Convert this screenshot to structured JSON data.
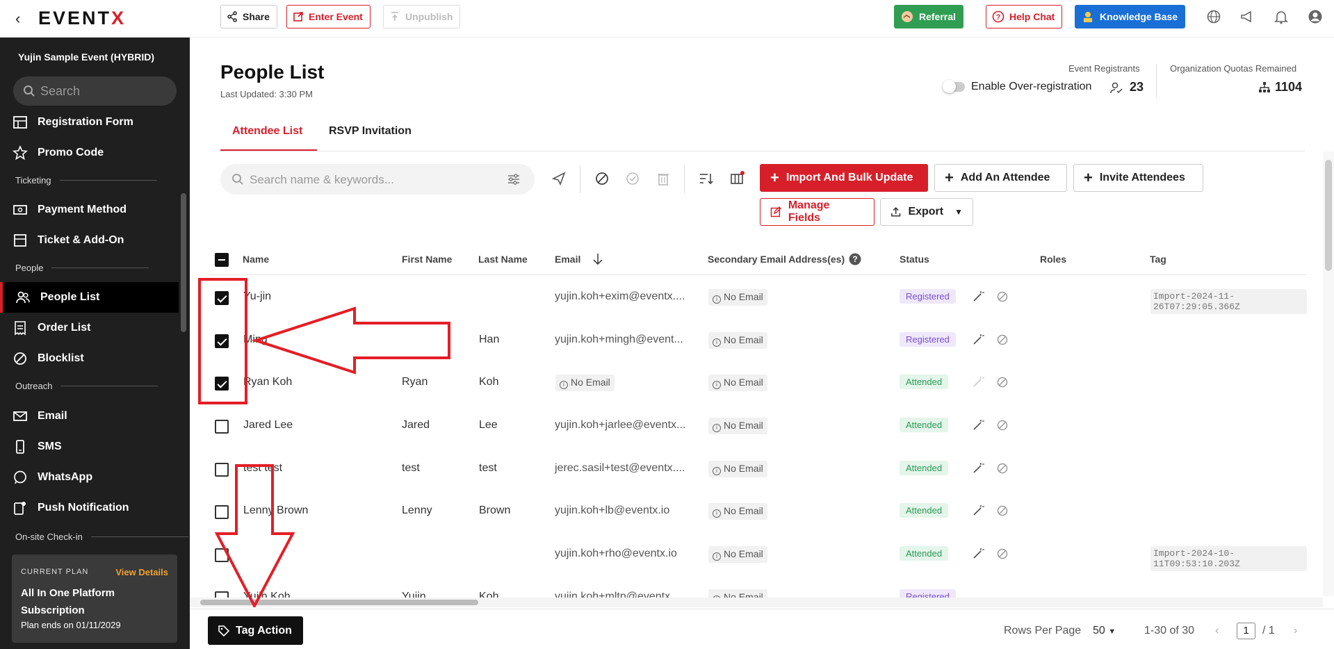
{
  "app": {
    "logo_text": "EVENT",
    "logo_accent": "X",
    "event_name": "Yujin Sample Event (HYBRID)",
    "brand_color": "#d71f2a"
  },
  "sidebar": {
    "search_placeholder": "Search",
    "items": [
      {
        "label": "Registration Form",
        "icon": "table-icon"
      },
      {
        "label": "Promo Code",
        "icon": "star-icon"
      },
      {
        "label": "Payment Method",
        "icon": "payment-icon"
      },
      {
        "label": "Ticket & Add-On",
        "icon": "ticket-icon"
      },
      {
        "label": "People List",
        "icon": "people-icon",
        "active": true
      },
      {
        "label": "Order List",
        "icon": "receipt-icon"
      },
      {
        "label": "Blocklist",
        "icon": "block-icon"
      },
      {
        "label": "Email",
        "icon": "mail-icon"
      },
      {
        "label": "SMS",
        "icon": "phone-icon"
      },
      {
        "label": "WhatsApp",
        "icon": "whatsapp-icon"
      },
      {
        "label": "Push Notification",
        "icon": "push-notification-icon"
      }
    ],
    "sections": [
      "Ticketing",
      "People",
      "Outreach",
      "On-site Check-in"
    ],
    "plan": {
      "label": "CURRENT PLAN",
      "view_details": "View Details",
      "name": "All In One Platform Subscription",
      "ends": "Plan ends on 01/11/2029"
    }
  },
  "topbar": {
    "share": "Share",
    "enter_event": "Enter Event",
    "unpublish": "Unpublish",
    "referral": "Referral",
    "help_chat": "Help Chat",
    "knowledge_base": "Knowledge Base"
  },
  "header": {
    "title": "People List",
    "last_updated": "Last Updated: 3:30 PM",
    "registrants_label": "Event Registrants",
    "over_registration": "Enable Over-registration",
    "registrants_count": "23",
    "quota_label": "Organization Quotas Remained",
    "quota_count": "1104"
  },
  "tabs": [
    {
      "label": "Attendee List",
      "active": true
    },
    {
      "label": "RSVP Invitation",
      "active": false
    }
  ],
  "toolbar": {
    "search_placeholder": "Search name & keywords...",
    "import_bulk": "Import And Bulk Update",
    "add_attendee": "Add An Attendee",
    "invite_attendees": "Invite Attendees",
    "manage_fields": "Manage Fields",
    "export": "Export"
  },
  "table": {
    "columns": [
      "Name",
      "First Name",
      "Last Name",
      "Email",
      "Secondary Email Address(es)",
      "Status",
      "Roles",
      "Tag"
    ],
    "no_email": "No Email",
    "rows": [
      {
        "checked": true,
        "name": "Yu-jin",
        "first": "",
        "last": "",
        "email": "yujin.koh+exim@eventx....",
        "status": "Registered",
        "tag": "Import-2024-11-26T07:29:05.366Z"
      },
      {
        "checked": true,
        "name": "Ming",
        "first": "",
        "last": "Han",
        "email": "yujin.koh+mingh@event...",
        "status": "Registered",
        "tag": ""
      },
      {
        "checked": true,
        "name": "Ryan Koh",
        "first": "Ryan",
        "last": "Koh",
        "email": "",
        "status": "Attended",
        "tag": ""
      },
      {
        "checked": false,
        "name": "Jared Lee",
        "first": "Jared",
        "last": "Lee",
        "email": "yujin.koh+jarlee@eventx...",
        "status": "Attended",
        "tag": ""
      },
      {
        "checked": false,
        "name": "test test",
        "first": "test",
        "last": "test",
        "email": "jerec.sasil+test@eventx....",
        "status": "Attended",
        "tag": ""
      },
      {
        "checked": false,
        "name": "Lenny Brown",
        "first": "Lenny",
        "last": "Brown",
        "email": "yujin.koh+lb@eventx.io",
        "status": "Attended",
        "tag": ""
      },
      {
        "checked": false,
        "name": "",
        "first": "",
        "last": "",
        "email": "yujin.koh+rho@eventx.io",
        "status": "Attended",
        "tag": "Import-2024-10-11T09:53:10.203Z"
      },
      {
        "checked": false,
        "name": "Yujin Koh",
        "first": "Yujin",
        "last": "Koh",
        "email": "yujin.koh+mltp@eventx...",
        "status": "Registered",
        "tag": ""
      }
    ]
  },
  "footer": {
    "tag_action": "Tag Action",
    "rows_per_page_label": "Rows Per Page",
    "rows_per_page": "50",
    "range": "1-30 of 30",
    "page": "1",
    "page_total": "/ 1"
  }
}
